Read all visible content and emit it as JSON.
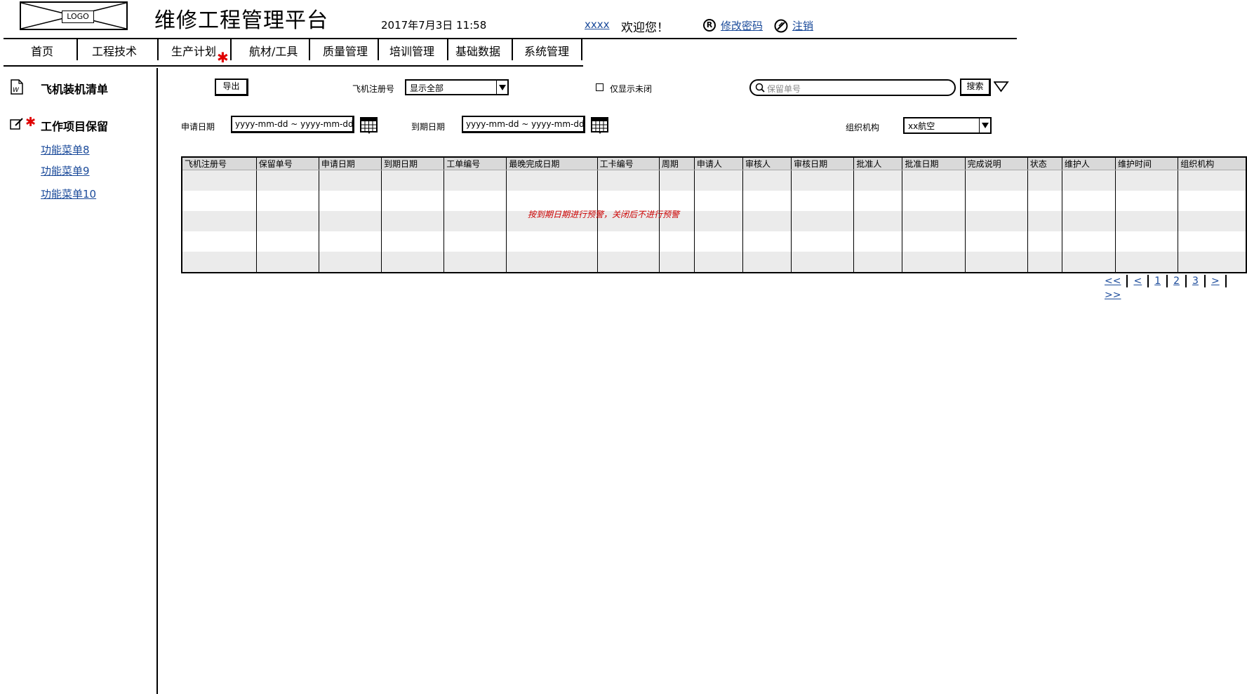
{
  "header": {
    "logo_text": "LOGO",
    "title": "维修工程管理平台",
    "datetime": "2017年7月3日  11:58",
    "username": "xxxx",
    "welcome": "欢迎您！",
    "change_password": "修改密码",
    "change_password_icon": "R",
    "logout": "注销"
  },
  "nav": {
    "items": [
      "首页",
      "工程技术",
      "生产计划",
      "航材/工具",
      "质量管理",
      "培训管理",
      "基础数据",
      "系统管理"
    ]
  },
  "sidebar": {
    "item1": "飞机装机清单",
    "item2": "工作项目保留",
    "links": [
      "功能菜单8",
      "功能菜单9",
      "功能菜单10"
    ]
  },
  "toolbar": {
    "export_label": "导出",
    "reg_label": "飞机注册号",
    "reg_value": "显示全部",
    "unclosed_label": "仅显示未闭",
    "search_placeholder": "保留单号",
    "search_label": "搜索",
    "apply_date_label": "申请日期",
    "apply_date_value": "yyyy-mm-dd ~ yyyy-mm-dd",
    "due_date_label": "到期日期",
    "due_date_value": "yyyy-mm-dd ~ yyyy-mm-dd",
    "org_label": "组织机构",
    "org_value": "xx航空"
  },
  "table": {
    "columns": [
      "飞机注册号",
      "保留单号",
      "申请日期",
      "到期日期",
      "工单编号",
      "最晚完成日期",
      "工卡编号",
      "周期",
      "申请人",
      "审核人",
      "审核日期",
      "批准人",
      "批准日期",
      "完成说明",
      "状态",
      "维护人",
      "维护时间",
      "组织机构"
    ],
    "note": "按到期日期进行预警，关闭后不进行预警"
  },
  "pager": {
    "first": "<<",
    "prev": "<",
    "pages": [
      "1",
      "2",
      "3"
    ],
    "next": ">",
    "last": ">>"
  },
  "colors": {
    "link": "#1a4a9a",
    "accent_red": "#e00000",
    "header_gray": "#d9d9d9"
  },
  "icons": [
    "logo-placeholder",
    "revise-icon",
    "logout-icon",
    "document-icon",
    "edit-icon",
    "asterisk-icon",
    "calendar-icon",
    "search-icon",
    "filter-icon"
  ]
}
